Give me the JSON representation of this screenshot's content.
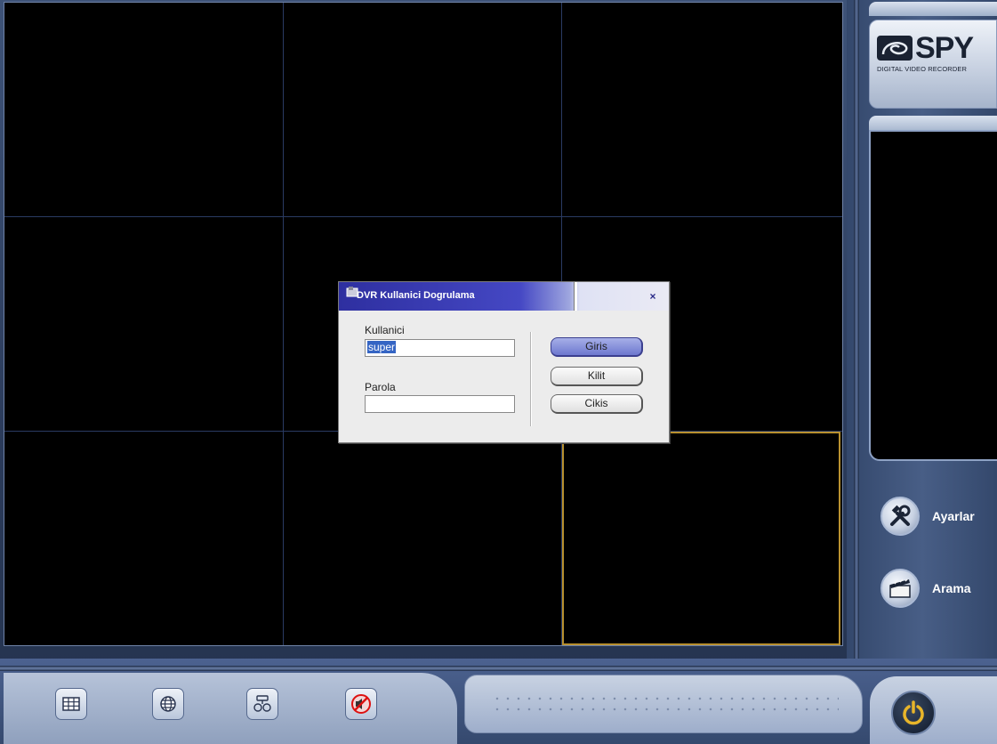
{
  "dialog": {
    "title": "DVR   Kullanici Dogrulama",
    "close": "×",
    "username_label": "Kullanici",
    "username_value": "super",
    "password_label": "Parola",
    "password_value": "",
    "login_button": "Giris",
    "lock_button": "Kilit",
    "exit_button": "Cikis"
  },
  "brand": {
    "logo_text": "SPY",
    "logo_subtitle": "DIGITAL VIDEO RECORDER"
  },
  "side_menu": {
    "settings_label": "Ayarlar",
    "search_label": "Arama"
  },
  "toolbar": {
    "icons": [
      "grid-layout-icon",
      "network-icon",
      "ptz-icon",
      "mute-icon"
    ]
  },
  "colors": {
    "selected_cell_border": "#b8902f",
    "dialog_title_bg": "#2e2fa0",
    "primary_button": "#6d78cf",
    "power_icon": "#e8b52a"
  }
}
